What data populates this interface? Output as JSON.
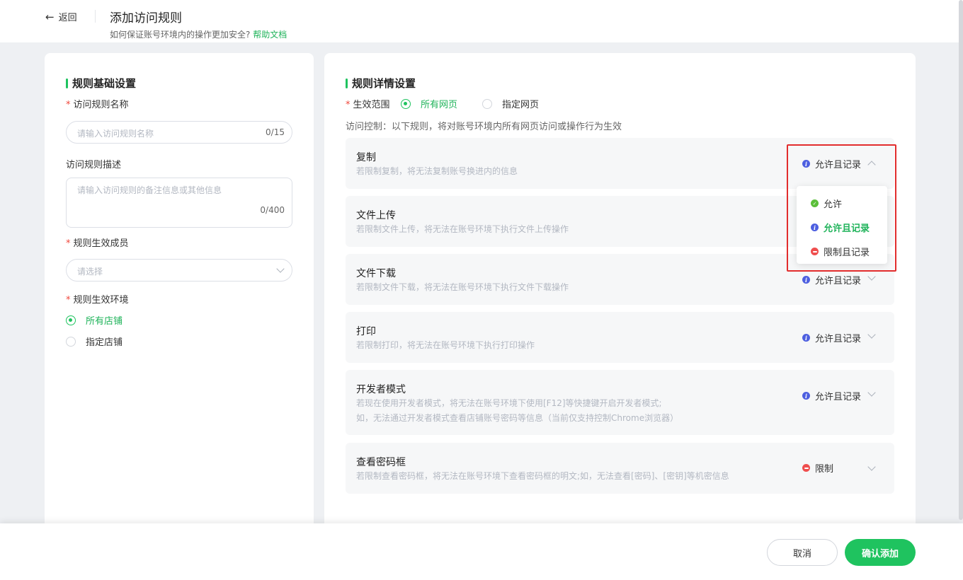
{
  "header": {
    "back_label": "返回",
    "title": "添加访问规则",
    "subtitle": "如何保证账号环境内的操作更加安全?",
    "help_link": "帮助文档"
  },
  "left": {
    "section_title": "规则基础设置",
    "name_label": "访问规则名称",
    "name_placeholder": "请输入访问规则名称",
    "name_count": "0/15",
    "desc_label": "访问规则描述",
    "desc_placeholder": "请输入访问规则的备注信息或其他信息",
    "desc_count": "0/400",
    "members_label": "规则生效成员",
    "members_placeholder": "请选择",
    "env_label": "规则生效环境",
    "env_options": [
      "所有店铺",
      "指定店铺"
    ],
    "env_selected": "所有店铺"
  },
  "right": {
    "section_title": "规则详情设置",
    "scope_label": "生效范围",
    "scope_options": [
      "所有网页",
      "指定网页"
    ],
    "scope_selected": "所有网页",
    "hint": "访问控制：以下规则，将对账号环境内所有网页访问或操作行为生效",
    "permissions": [
      {
        "name": "复制",
        "desc": "若限制复制，将无法复制账号换进内的信息",
        "value": "允许且记录",
        "icon": "info-icon",
        "expanded": true
      },
      {
        "name": "文件上传",
        "desc": "若限制文件上传，将无法在账号环境下执行文件上传操作",
        "value": "允许且记录",
        "icon": "info-icon"
      },
      {
        "name": "文件下载",
        "desc": "若限制文件下载，将无法在账号环境下执行文件下载操作",
        "value": "允许且记录",
        "icon": "info-icon"
      },
      {
        "name": "打印",
        "desc": "若限制打印，将无法在账号环境下执行打印操作",
        "value": "允许且记录",
        "icon": "info-icon"
      },
      {
        "name": "开发者模式",
        "desc": "若现在使用开发者模式，将无法在账号环境下使用[F12]等快捷键开启开发者模式;",
        "desc2": "如，无法通过开发者模式查看店铺账号密码等信息（当前仅支持控制Chrome浏览器）",
        "value": "允许且记录",
        "icon": "info-icon"
      },
      {
        "name": "查看密码框",
        "desc": "若限制查看密码框，将无法在账号环境下查看密码框的明文;如，无法查看[密码]、[密钥]等机密信息",
        "value": "限制",
        "icon": "forbid-icon"
      }
    ],
    "dropdown_options": [
      {
        "label": "允许",
        "icon": "check-circle-icon"
      },
      {
        "label": "允许且记录",
        "icon": "info-icon",
        "selected": true
      },
      {
        "label": "限制且记录",
        "icon": "forbid-icon"
      }
    ]
  },
  "footer": {
    "cancel_label": "取消",
    "confirm_label": "确认添加"
  },
  "colors": {
    "accent": "#1fc35f",
    "info": "#4d5fe0",
    "danger": "#ef4e4e",
    "highlight_box": "#e22d2d"
  }
}
